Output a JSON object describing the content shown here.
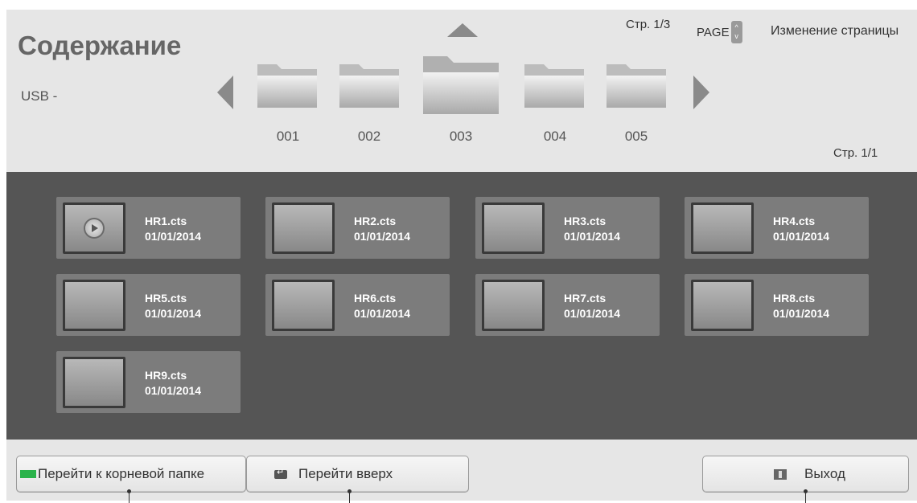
{
  "header": {
    "title": "Содержание",
    "source": "USB -",
    "page_indicator_top": "Стр. 1/3",
    "page_key": "PAGE",
    "page_change_label": "Изменение страницы",
    "page_indicator_bottom": "Стр. 1/1"
  },
  "folders": [
    {
      "label": "001"
    },
    {
      "label": "002"
    },
    {
      "label": "003",
      "selected": true
    },
    {
      "label": "004"
    },
    {
      "label": "005"
    }
  ],
  "files": [
    {
      "name": "HR1.cts",
      "date": "01/01/2014",
      "icon": "play-icon"
    },
    {
      "name": "HR2.cts",
      "date": "01/01/2014"
    },
    {
      "name": "HR3.cts",
      "date": "01/01/2014"
    },
    {
      "name": "HR4.cts",
      "date": "01/01/2014"
    },
    {
      "name": "HR5.cts",
      "date": "01/01/2014"
    },
    {
      "name": "HR6.cts",
      "date": "01/01/2014"
    },
    {
      "name": "HR7.cts",
      "date": "01/01/2014"
    },
    {
      "name": "HR8.cts",
      "date": "01/01/2014"
    },
    {
      "name": "HR9.cts",
      "date": "01/01/2014"
    }
  ],
  "buttons": {
    "root": "Перейти к корневой папке",
    "up": "Перейти вверх",
    "exit": "Выход"
  },
  "colors": {
    "green_key": "#2ab34a",
    "grid_background": "#555555",
    "card_background": "#7c7c7c"
  }
}
